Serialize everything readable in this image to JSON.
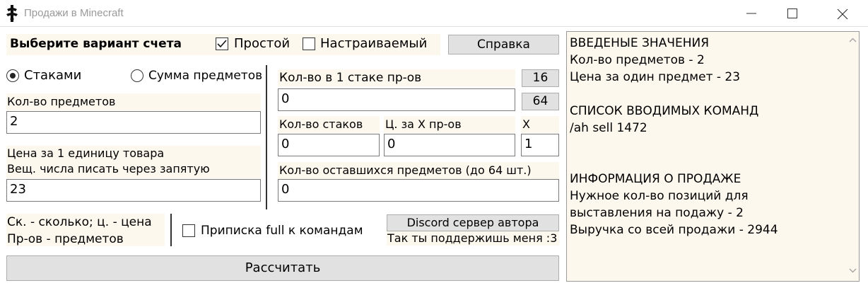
{
  "window": {
    "title": "Продажи в Minecraft"
  },
  "left": {
    "header_label": "Выберите вариант счета",
    "simple_label": "Простой",
    "simple_checked": true,
    "custom_label": "Настраиваемый",
    "custom_checked": false,
    "help_button": "Справка",
    "radio_stacks": "Стаками",
    "radio_sum": "Сумма предметов",
    "items_count_label": "Кол-во предметов",
    "items_count_value": "2",
    "price_label_1": "Цена за 1 единицу товара",
    "price_label_2": "Вещ. числа писать через запятую",
    "price_value": "23",
    "legend_1": "Ск. - сколько; ц. - цена",
    "legend_2": "Пр-ов - предметов",
    "full_suffix_label": "Приписка full к командам",
    "full_suffix_checked": false,
    "discord_button": "Discord сервер автора",
    "support_text": "Так ты поддержишь меня :3",
    "calc_button": "Рассчитать"
  },
  "middle": {
    "stack_size_label": "Кол-во в 1 стаке пр-ов",
    "stack_16_button": "16",
    "stack_64_button": "64",
    "stack_size_value": "0",
    "stacks_count_label": "Кол-во стаков",
    "price_x_label": "Ц. за X пр-ов",
    "x_label": "X",
    "stacks_count_value": "0",
    "price_x_value": "0",
    "x_value": "1",
    "remaining_label": "Кол-во оставшихся предметов (до 64 шт.)",
    "remaining_value": "0"
  },
  "output": {
    "lines": [
      "ВВЕДЕНЫЕ ЗНАЧЕНИЯ",
      "Кол-во предметов - 2",
      "Цена за один предмет - 23",
      "",
      "СПИСОК ВВОДИМЫХ КОМАНД",
      "/ah sell 1472",
      "",
      "",
      "ИНФОРМАЦИЯ О ПРОДАЖЕ",
      "Нужное кол-во позиций для",
      "выставления на подажу - 2",
      "Выручка со всей продажи - 2944"
    ]
  }
}
